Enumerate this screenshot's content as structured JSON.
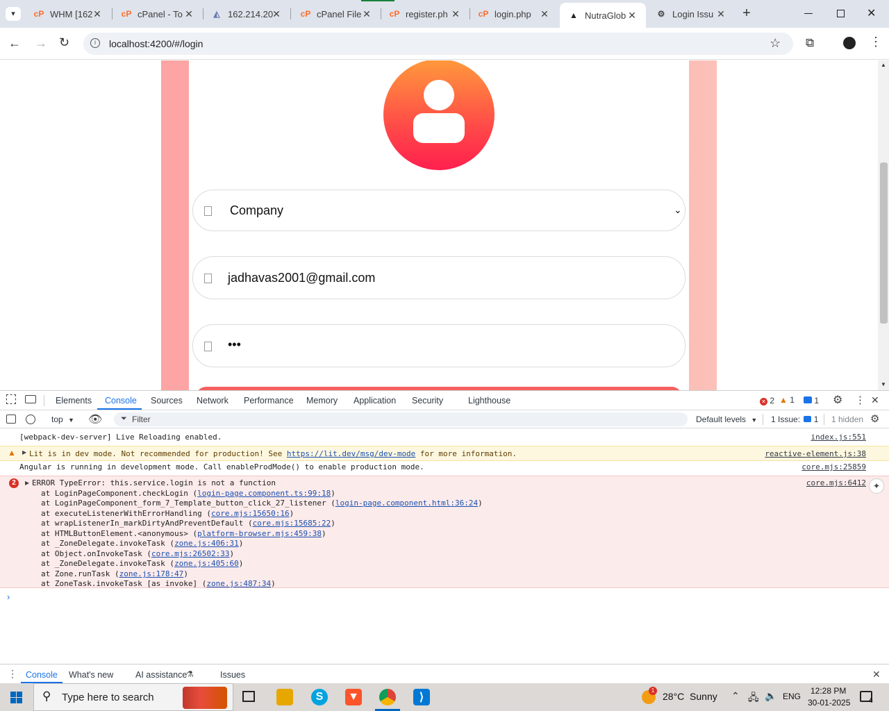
{
  "browser": {
    "tabs": [
      {
        "title": "WHM [162",
        "icon": "cpanel-icon"
      },
      {
        "title": "cPanel - To",
        "icon": "cpanel-icon"
      },
      {
        "title": "162.214.20",
        "icon": "phpmyadmin-icon"
      },
      {
        "title": "cPanel File",
        "icon": "cpanel-icon"
      },
      {
        "title": "register.ph",
        "icon": "cpanel-icon"
      },
      {
        "title": "login.php",
        "icon": "cpanel-icon"
      },
      {
        "title": "NutraGlob",
        "icon": "angular-icon",
        "active": true
      },
      {
        "title": "Login Issu",
        "icon": "chatgpt-icon"
      }
    ],
    "url": "localhost:4200/#/login"
  },
  "login": {
    "company_value": "Company",
    "email_value": "jadhavas2001@gmail.com",
    "password_value": "•••"
  },
  "devtools": {
    "tabs": [
      "Elements",
      "Console",
      "Sources",
      "Network",
      "Performance",
      "Memory",
      "Application",
      "Security",
      "Lighthouse"
    ],
    "selected_tab": "Console",
    "error_count": "2",
    "warning_count": "1",
    "issue_badge_count": "1",
    "context": "top",
    "filter_placeholder": "Filter",
    "levels": "Default levels",
    "issues_label": "1 Issue:",
    "issues_count": "1",
    "hidden_label": "1 hidden",
    "messages": {
      "m1": "[webpack-dev-server] Live Reloading enabled.",
      "m1_src": "index.js:551",
      "m2_prefix": "Lit is in dev mode. Not recommended for production! See ",
      "m2_link": "https://lit.dev/msg/dev-mode",
      "m2_suffix": " for more information.",
      "m2_src": "reactive-element.js:38",
      "m3": "Angular is running in development mode. Call enableProdMode() to enable production mode.",
      "m3_src": "core.mjs:25859",
      "err_count": "2",
      "err_title": "ERROR TypeError: this.service.login is not a function",
      "err_src": "core.mjs:6412",
      "stack": [
        {
          "text": "at LoginPageComponent.checkLogin (",
          "link": "login-page.component.ts:99:18"
        },
        {
          "text": "at LoginPageComponent_form_7_Template_button_click_27_listener (",
          "link": "login-page.component.html:36:24"
        },
        {
          "text": "at executeListenerWithErrorHandling (",
          "link": "core.mjs:15650:16"
        },
        {
          "text": "at wrapListenerIn_markDirtyAndPreventDefault (",
          "link": "core.mjs:15685:22"
        },
        {
          "text": "at HTMLButtonElement.<anonymous> (",
          "link": "platform-browser.mjs:459:38"
        },
        {
          "text": "at _ZoneDelegate.invokeTask (",
          "link": "zone.js:406:31"
        },
        {
          "text": "at Object.onInvokeTask (",
          "link": "core.mjs:26502:33"
        },
        {
          "text": "at _ZoneDelegate.invokeTask (",
          "link": "zone.js:405:60"
        },
        {
          "text": "at Zone.runTask (",
          "link": "zone.js:178:47"
        },
        {
          "text": "at ZoneTask.invokeTask [as invoke] (",
          "link": "zone.js:487:34"
        }
      ]
    },
    "drawer_tabs": [
      "Console",
      "What's new",
      "AI assistance",
      "Issues"
    ]
  },
  "taskbar": {
    "search_placeholder": "Type here to search",
    "weather": "28°C  Sunny",
    "weather_badge": "1",
    "language": "ENG",
    "time": "12:28 PM",
    "date": "30-01-2025",
    "notification_count": "4"
  }
}
